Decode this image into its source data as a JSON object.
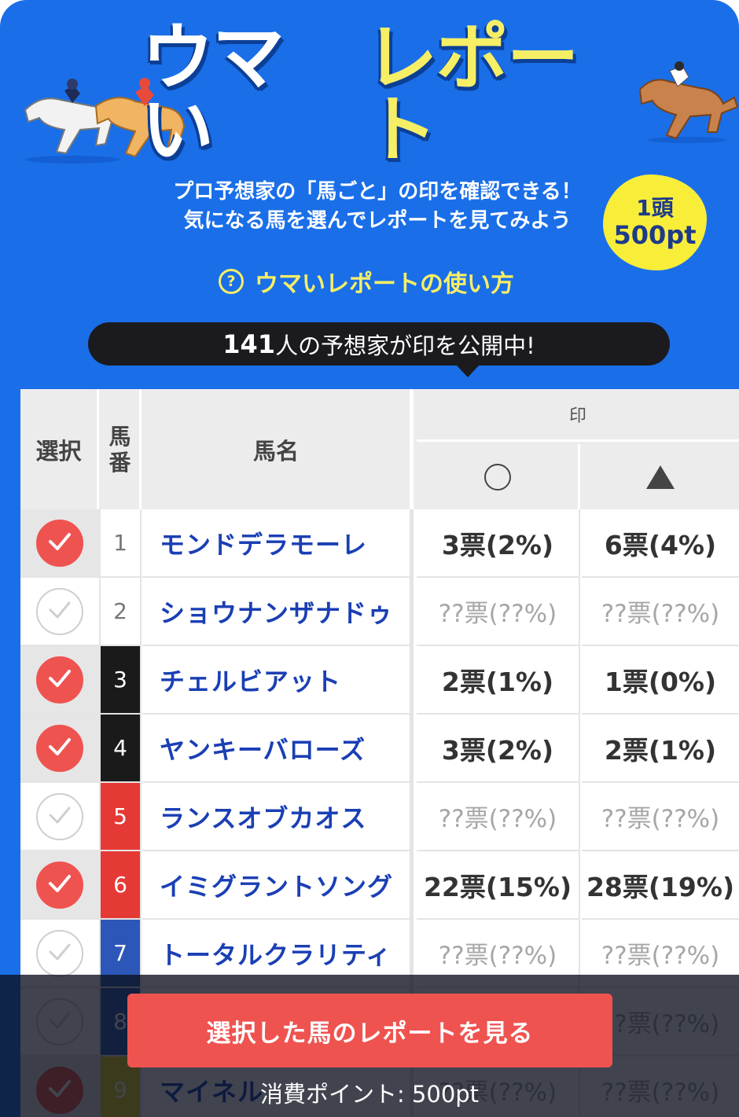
{
  "header": {
    "title_white": "ウマい",
    "title_yellow": "レポート",
    "lead_line1": "プロ予想家の「馬ごと」の印を確認できる！",
    "lead_line2": "気になる馬を選んでレポートを見てみよう",
    "badge_line1": "1頭",
    "badge_line2": "500pt",
    "howto_icon": "?",
    "howto_label": "ウマいレポートの使い方",
    "count_number": "141",
    "count_suffix": "人の予想家が印を公開中!"
  },
  "table": {
    "col_select": "選択",
    "col_num_1": "馬",
    "col_num_2": "番",
    "col_name": "馬名",
    "col_mark": "印",
    "rows": [
      {
        "selected": true,
        "num": "1",
        "name": "モンドデラモーレ",
        "v1": "3票(2%)",
        "v2": "6票(4%)",
        "hidden": false
      },
      {
        "selected": false,
        "num": "2",
        "name": "ショウナンザナドゥ",
        "v1": "??票(??%)",
        "v2": "??票(??%)",
        "hidden": true
      },
      {
        "selected": true,
        "num": "3",
        "name": "チェルビアット",
        "v1": "2票(1%)",
        "v2": "1票(0%)",
        "hidden": false
      },
      {
        "selected": true,
        "num": "4",
        "name": "ヤンキーバローズ",
        "v1": "3票(2%)",
        "v2": "2票(1%)",
        "hidden": false
      },
      {
        "selected": false,
        "num": "5",
        "name": "ランスオブカオス",
        "v1": "??票(??%)",
        "v2": "??票(??%)",
        "hidden": true
      },
      {
        "selected": true,
        "num": "6",
        "name": "イミグラントソング",
        "v1": "22票(15%)",
        "v2": "28票(19%)",
        "hidden": false
      },
      {
        "selected": false,
        "num": "7",
        "name": "トータルクラリティ",
        "v1": "??票(??%)",
        "v2": "??票(??%)",
        "hidden": true
      },
      {
        "selected": false,
        "num": "8",
        "name": "",
        "v1": "",
        "v2": "??票(??%)",
        "hidden": true
      },
      {
        "selected": true,
        "num": "9",
        "name": "マイネル",
        "v1": "??票(??%)",
        "v2": "??票(??%)",
        "hidden": true
      }
    ]
  },
  "colors": {
    "brand_blue": "#1a6fe8",
    "accent_red": "#ef5350",
    "title_yellow": "#f6ef66",
    "badge_yellow": "#f8ee3a",
    "frame_black": "#1a1a1a",
    "frame_red": "#e53935",
    "frame_blue": "#2c57b8",
    "frame_yellow": "#e8d21c"
  },
  "footer": {
    "cta_label": "選択した馬のレポートを見る",
    "points_label": "消費ポイント: 500pt"
  }
}
